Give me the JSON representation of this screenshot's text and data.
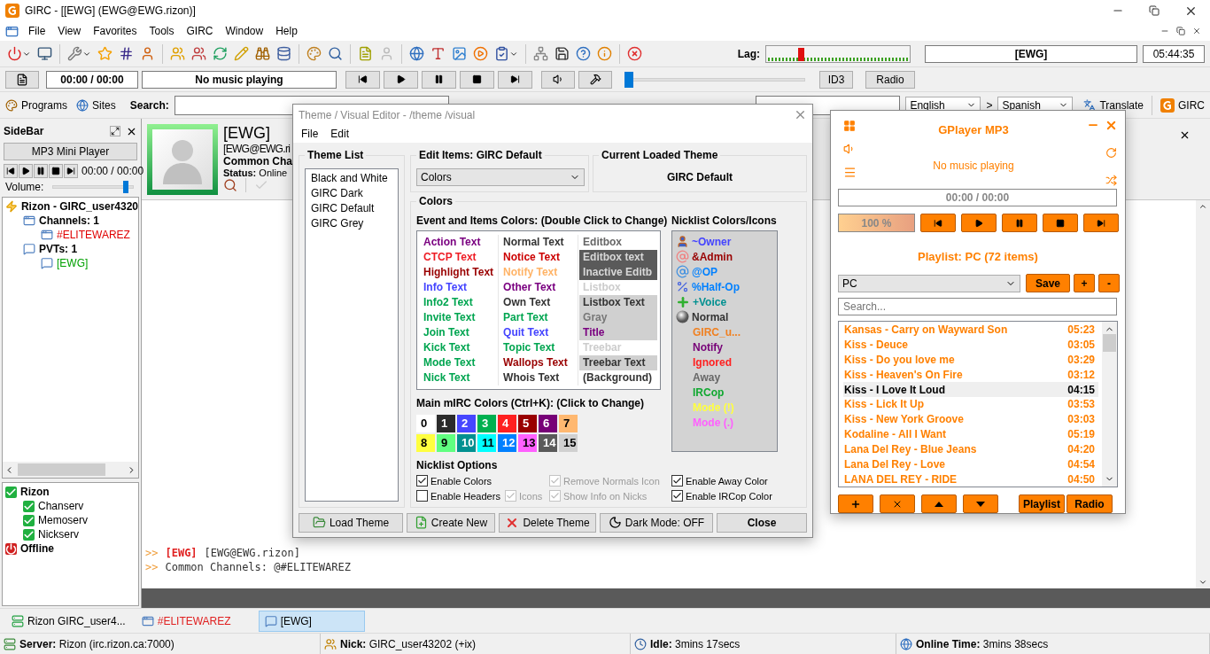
{
  "window": {
    "title": "GIRC - [[EWG] (EWG@EWG.rizon)]"
  },
  "menu": [
    "File",
    "View",
    "Favorites",
    "Tools",
    "GIRC",
    "Window",
    "Help"
  ],
  "toolbar": {
    "lag": {
      "label": "Lag:"
    },
    "channel_field": "[EWG]",
    "clock": "05:44:35"
  },
  "music_bar": {
    "time": "00:00 / 00:00",
    "now_playing": "No music playing",
    "seek": {
      "level": 0
    },
    "buttons": [
      "ID3",
      "Radio"
    ]
  },
  "search_bar": {
    "links": [
      "Programs",
      "Sites"
    ],
    "search_label": "Search:",
    "from_language": "English",
    "separator": ">",
    "to_language": "Spanish",
    "translate": "Translate",
    "brand": "GIRC"
  },
  "sidebar": {
    "title": "SideBar",
    "player_button": "MP3 Mini Player",
    "time": "00:00 / 00:00",
    "volume": {
      "label": "Volume:",
      "level": 0.93
    },
    "tree": [
      {
        "label": "Rizon - GIRC_user4320",
        "kind": "server",
        "children": [
          {
            "label": "Channels: 1",
            "kind": "channels",
            "children": [
              {
                "label": "#ELITEWAREZ",
                "kind": "channels",
                "color": "#e00000"
              }
            ]
          },
          {
            "label": "PVTs: 1",
            "kind": "query",
            "children": [
              {
                "label": "[EWG]",
                "kind": "query",
                "color": "#00a000"
              }
            ]
          }
        ]
      }
    ],
    "services": [
      {
        "label": "Rizon",
        "kind": "online",
        "children": [
          {
            "label": "Chanserv",
            "kind": "online"
          },
          {
            "label": "Memoserv",
            "kind": "online"
          },
          {
            "label": "Nickserv",
            "kind": "online"
          }
        ]
      },
      {
        "label": "Offline",
        "kind": "offline"
      }
    ]
  },
  "profile": {
    "name": "[EWG]",
    "host": "[EWG@EWG.ri",
    "channels": "Common Cha",
    "status": "**Status:** Online"
  },
  "messages": [
    {
      "prefix": ">>",
      "nick": "[EWG]",
      "text": "[EWG@EWG.rizon]"
    },
    {
      "prefix": ">>",
      "text": "Common Channels: @#ELITEWAREZ"
    }
  ],
  "taskbar": [
    {
      "label": "Rizon GIRC_user4...",
      "kind": "server",
      "color": "#000000",
      "selected": false
    },
    {
      "label": "#ELITEWAREZ",
      "kind": "channel",
      "color": "#e02020",
      "selected": false
    },
    {
      "label": "[EWG]",
      "kind": "query",
      "color": "#000000",
      "selected": true
    }
  ],
  "status_bar": [
    {
      "kind": "server",
      "text": "**Server:** Rizon (irc.rizon.ca:7000)"
    },
    {
      "kind": "nick",
      "text": "**Nick:** GIRC_user43202 (+ix)"
    },
    {
      "kind": "idle",
      "text": "**Idle:** 3mins 17secs"
    },
    {
      "kind": "online",
      "text": "**Online Time:** 3mins 38secs"
    }
  ],
  "theme_editor": {
    "title": "Theme / Visual Editor - /theme /visual",
    "menu": [
      "File",
      "Edit"
    ],
    "theme_list": {
      "title": "Theme List",
      "items": [
        {
          "label": "Black and White",
          "selected": false
        },
        {
          "label": "GIRC Dark",
          "selected": false
        },
        {
          "label": "GIRC Default",
          "selected": false
        },
        {
          "label": "GIRC Grey",
          "selected": false
        }
      ]
    },
    "edit_items": {
      "title": "Edit Items: GIRC Default",
      "value": "Colors"
    },
    "current_theme": {
      "title": "Current Loaded Theme",
      "value": "GIRC Default"
    },
    "colors": {
      "title": "Colors",
      "events_title": "Event and Items Colors: (Double Click to Change)",
      "event_columns": [
        [
          {
            "label": "Action Text",
            "color": "#7a0080",
            "kind": "plain"
          },
          {
            "label": "CTCP Text",
            "color": "#ee1c24",
            "kind": "plain"
          },
          {
            "label": "Highlight Text",
            "color": "#990000",
            "kind": "plain"
          },
          {
            "label": "Info Text",
            "color": "#4444ff",
            "kind": "plain"
          },
          {
            "label": "Info2 Text",
            "color": "#00a550",
            "kind": "plain"
          },
          {
            "label": "Invite Text",
            "color": "#00a550",
            "kind": "plain"
          },
          {
            "label": "Join Text",
            "color": "#00a550",
            "kind": "plain"
          },
          {
            "label": "Kick Text",
            "color": "#00a550",
            "kind": "plain"
          },
          {
            "label": "Mode Text",
            "color": "#00a550",
            "kind": "plain"
          },
          {
            "label": "Nick Text",
            "color": "#00a550",
            "kind": "plain"
          }
        ],
        [
          {
            "label": "Normal Text",
            "color": "#333333",
            "kind": "plain"
          },
          {
            "label": "Notice Text",
            "color": "#cc0000",
            "kind": "plain"
          },
          {
            "label": "Notify Text",
            "color": "#ffb366",
            "kind": "plain"
          },
          {
            "label": "Other Text",
            "color": "#7a0080",
            "kind": "plain"
          },
          {
            "label": "Own Text",
            "color": "#333333",
            "kind": "plain"
          },
          {
            "label": "Part Text",
            "color": "#00a550",
            "kind": "plain"
          },
          {
            "label": "Quit Text",
            "color": "#4444ff",
            "kind": "plain"
          },
          {
            "label": "Topic Text",
            "color": "#00a550",
            "kind": "plain"
          },
          {
            "label": "Wallops Text",
            "color": "#990000",
            "kind": "plain"
          },
          {
            "label": "Whois Text",
            "color": "#333333",
            "kind": "plain"
          }
        ],
        [
          {
            "label": "Editbox",
            "color": "#666666",
            "kind": "plain"
          },
          {
            "label": "Editbox text",
            "color": "#d8d8d8",
            "kind": "dark"
          },
          {
            "label": "Inactive Editb",
            "color": "#d8d8d8",
            "kind": "dark"
          },
          {
            "label": "Listbox",
            "color": "#cccccc",
            "kind": "plain"
          },
          {
            "label": "Listbox Text",
            "color": "#333333",
            "kind": "shaded"
          },
          {
            "label": "Gray",
            "color": "#777777",
            "kind": "shaded"
          },
          {
            "label": "Title",
            "color": "#7a0080",
            "kind": "shaded"
          },
          {
            "label": "Treebar",
            "color": "#cccccc",
            "kind": "plain"
          },
          {
            "label": "Treebar Text",
            "color": "#333333",
            "kind": "shaded"
          },
          {
            "label": "(Background)",
            "color": "#333333",
            "kind": "plain"
          }
        ]
      ],
      "mirc_title": "Main mIRC Colors (Ctrl+K): (Click to Change)",
      "mirc": [
        {
          "label": "0",
          "color": "#ffffff"
        },
        {
          "label": "1",
          "color": "#2b2b2b"
        },
        {
          "label": "2",
          "color": "#4646ff"
        },
        {
          "label": "3",
          "color": "#00b050"
        },
        {
          "label": "4",
          "color": "#ff2020"
        },
        {
          "label": "5",
          "color": "#990000"
        },
        {
          "label": "6",
          "color": "#770077"
        },
        {
          "label": "7",
          "color": "#ffb870"
        },
        {
          "label": "8",
          "color": "#ffff40"
        },
        {
          "label": "9",
          "color": "#60ff80"
        },
        {
          "label": "10",
          "color": "#009090"
        },
        {
          "label": "11",
          "color": "#00ffff"
        },
        {
          "label": "12",
          "color": "#0080ff"
        },
        {
          "label": "13",
          "color": "#ff60ff"
        },
        {
          "label": "14",
          "color": "#5a5a5a"
        },
        {
          "label": "15",
          "color": "#d0d0d0"
        }
      ],
      "nicklist_title": "Nicklist Colors/Icons",
      "nicklist": [
        {
          "label": "~Owner",
          "color": "#4444ff",
          "kind": "owner"
        },
        {
          "label": "&Admin",
          "color": "#990000",
          "kind": "admin"
        },
        {
          "label": "@OP",
          "color": "#0080ff",
          "kind": "op"
        },
        {
          "label": "%Half-Op",
          "color": "#0080ff",
          "kind": "halfop"
        },
        {
          "label": "+Voice",
          "color": "#009090",
          "kind": "voice"
        },
        {
          "label": "Normal",
          "color": "#333333",
          "kind": "normal"
        },
        {
          "label": "GIRC_u...",
          "color": "#f08020",
          "kind": "none"
        },
        {
          "label": "Notify",
          "color": "#770077",
          "kind": "none"
        },
        {
          "label": "Ignored",
          "color": "#ff2020",
          "kind": "none"
        },
        {
          "label": "Away",
          "color": "#666666",
          "kind": "none"
        },
        {
          "label": "IRCop",
          "color": "#10a830",
          "kind": "none"
        },
        {
          "label": "Mode (!)",
          "color": "#ffff40",
          "kind": "none"
        },
        {
          "label": "Mode (.)",
          "color": "#ff60ff",
          "kind": "none"
        }
      ],
      "options_title": "Nicklist Options",
      "option_rows": [
        [
          {
            "label": "Enable Colors",
            "checked": true,
            "disabled": false
          },
          {
            "label": "Remove Normals Icon",
            "checked": true,
            "disabled": true
          }
        ],
        [
          {
            "label": "Enable Headers",
            "checked": false,
            "disabled": false
          },
          {
            "label": "Icons",
            "checked": true,
            "disabled": true
          },
          {
            "label": "Show Info on Nicks",
            "checked": true,
            "disabled": true
          }
        ]
      ],
      "nick_options": [
        {
          "label": "Enable Away Color",
          "checked": true,
          "disabled": false
        },
        {
          "label": "Enable IRCop Color",
          "checked": true,
          "disabled": false
        }
      ]
    },
    "buttons": [
      {
        "label": "Load Theme",
        "kind": "load"
      },
      {
        "label": "Create New",
        "kind": "create"
      },
      {
        "label": "Delete Theme",
        "kind": "delete"
      },
      {
        "label": "Dark Mode: OFF",
        "kind": "dark"
      },
      {
        "label": "Close",
        "kind": "close"
      }
    ]
  },
  "player": {
    "title": "GPlayer MP3",
    "status": "No music playing",
    "time": "00:00 / 00:00",
    "volume": {
      "label": "100 %",
      "level": 1
    },
    "playlist_title": "Playlist: PC (72 items)",
    "playlist_select": "PC",
    "playlist_buttons": [
      "Save",
      "+",
      "-"
    ],
    "search_placeholder": "Search...",
    "tracks": [
      {
        "title": "Kansas - Carry on Wayward Son",
        "time": "05:23",
        "selected": false
      },
      {
        "title": "Kiss - Deuce",
        "time": "03:05",
        "selected": false
      },
      {
        "title": "Kiss - Do you love me",
        "time": "03:29",
        "selected": false
      },
      {
        "title": "Kiss - Heaven's On Fire",
        "time": "03:12",
        "selected": false
      },
      {
        "title": "Kiss - I Love It Loud",
        "time": "04:15",
        "selected": true
      },
      {
        "title": "Kiss - Lick It Up",
        "time": "03:53",
        "selected": false
      },
      {
        "title": "Kiss - New York Groove",
        "time": "03:03",
        "selected": false
      },
      {
        "title": "Kodaline - All I Want",
        "time": "05:19",
        "selected": false
      },
      {
        "title": "Lana Del Rey - Blue Jeans",
        "time": "04:20",
        "selected": false
      },
      {
        "title": "Lana Del Rey - Love",
        "time": "04:54",
        "selected": false
      },
      {
        "title": "LANA DEL REY - RIDE",
        "time": "04:50",
        "selected": false
      }
    ],
    "bottom_buttons": [
      "Playlist",
      "Radio"
    ]
  }
}
